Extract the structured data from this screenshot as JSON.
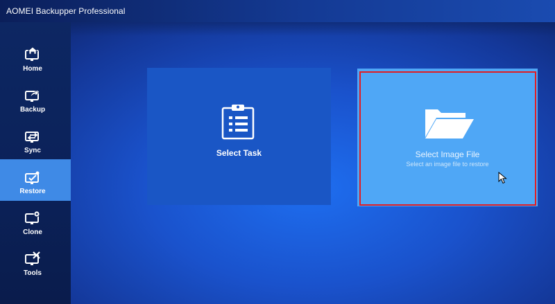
{
  "window": {
    "title": "AOMEI Backupper Professional"
  },
  "sidebar": {
    "items": [
      {
        "label": "Home",
        "icon": "home-icon"
      },
      {
        "label": "Backup",
        "icon": "backup-icon"
      },
      {
        "label": "Sync",
        "icon": "sync-icon"
      },
      {
        "label": "Restore",
        "icon": "restore-icon",
        "active": true
      },
      {
        "label": "Clone",
        "icon": "clone-icon"
      },
      {
        "label": "Tools",
        "icon": "tools-icon"
      }
    ]
  },
  "main": {
    "cards": [
      {
        "title": "Select Task",
        "subtitle": "",
        "icon": "clipboard-list-icon"
      },
      {
        "title": "Select Image File",
        "subtitle": "Select an image file to restore",
        "icon": "folder-icon"
      }
    ]
  },
  "colors": {
    "accent_active": "#3f8ae6",
    "highlight_border": "#e21b22",
    "card_task_bg": "#1a56c5",
    "card_image_bg": "#4fa7f6"
  }
}
